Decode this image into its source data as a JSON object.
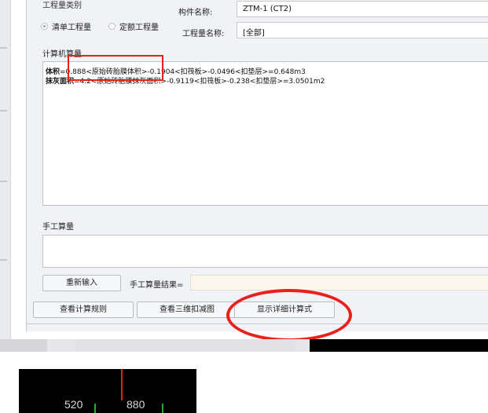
{
  "top": {
    "group_label": "工程量类别",
    "radio_list": "清单工程量",
    "radio_quota": "定额工程量",
    "component_name_label": "构件名称:",
    "component_name_value": "ZTM-1  (CT2)",
    "quantity_name_label": "工程量名称:",
    "quantity_name_value": "[全部]"
  },
  "computer_calc": {
    "title": "计算机算量",
    "line1_label": "体积",
    "line1_body": "=0.888<原始砖胎膜体积>-0.1904<扣筏板>-0.0496<扣垫层>=0.648m3",
    "line2_label": "抹灰面积",
    "line2_body": "=4.2<原始砖胎膜抹灰面积>-0.9119<扣筏板>-0.238<扣垫层>=3.0501m2"
  },
  "manual_calc": {
    "title": "手工算量",
    "reenter_button": "重新输入",
    "result_label": "手工算量结果="
  },
  "footer_buttons": {
    "rules": "查看计算规则",
    "view3d": "查看三维扣减图",
    "detail": "显示详细计算式"
  },
  "thumbnail": {
    "num_left": "520",
    "num_right": "880"
  },
  "colors": {
    "annotation_red": "#e8211c",
    "dialog_bg": "#f1f2f5",
    "result_bg": "#fdf6ea"
  }
}
